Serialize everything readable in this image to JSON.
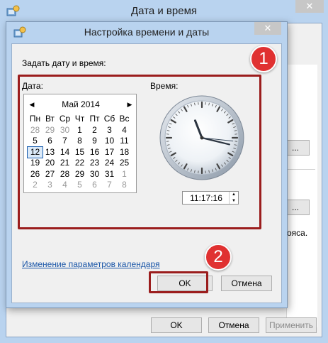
{
  "parent_window": {
    "title": "Дата и время",
    "close_glyph": "✕",
    "fragment_button_1": "...",
    "fragment_button_2": "...",
    "fragment_text": "ояса.",
    "ok_label": "OK",
    "cancel_label": "Отмена",
    "apply_label": "Применить"
  },
  "dialog": {
    "title": "Настройка времени и даты",
    "close_glyph": "✕",
    "heading": "Задать дату и время:",
    "date_label": "Дата:",
    "time_label": "Время:",
    "calendar": {
      "month_label": "Май 2014",
      "prev_glyph": "◀",
      "next_glyph": "▶",
      "weekdays": [
        "Пн",
        "Вт",
        "Ср",
        "Чт",
        "Пт",
        "Сб",
        "Вс"
      ],
      "weeks": [
        [
          "28",
          "29",
          "30",
          "1",
          "2",
          "3",
          "4"
        ],
        [
          "5",
          "6",
          "7",
          "8",
          "9",
          "10",
          "11"
        ],
        [
          "12",
          "13",
          "14",
          "15",
          "16",
          "17",
          "18"
        ],
        [
          "19",
          "20",
          "21",
          "22",
          "23",
          "24",
          "25"
        ],
        [
          "26",
          "27",
          "28",
          "29",
          "30",
          "31",
          "1"
        ],
        [
          "2",
          "3",
          "4",
          "5",
          "6",
          "7",
          "8"
        ]
      ],
      "selected_day": "12"
    },
    "time_value": "11:17:16",
    "calendar_settings_link": "Изменение параметров календаря",
    "ok_label": "OK",
    "cancel_label": "Отмена"
  },
  "annotations": {
    "badge_1": "1",
    "badge_2": "2",
    "highlight_color": "#9b1d1d",
    "badge_color": "#e03131"
  }
}
